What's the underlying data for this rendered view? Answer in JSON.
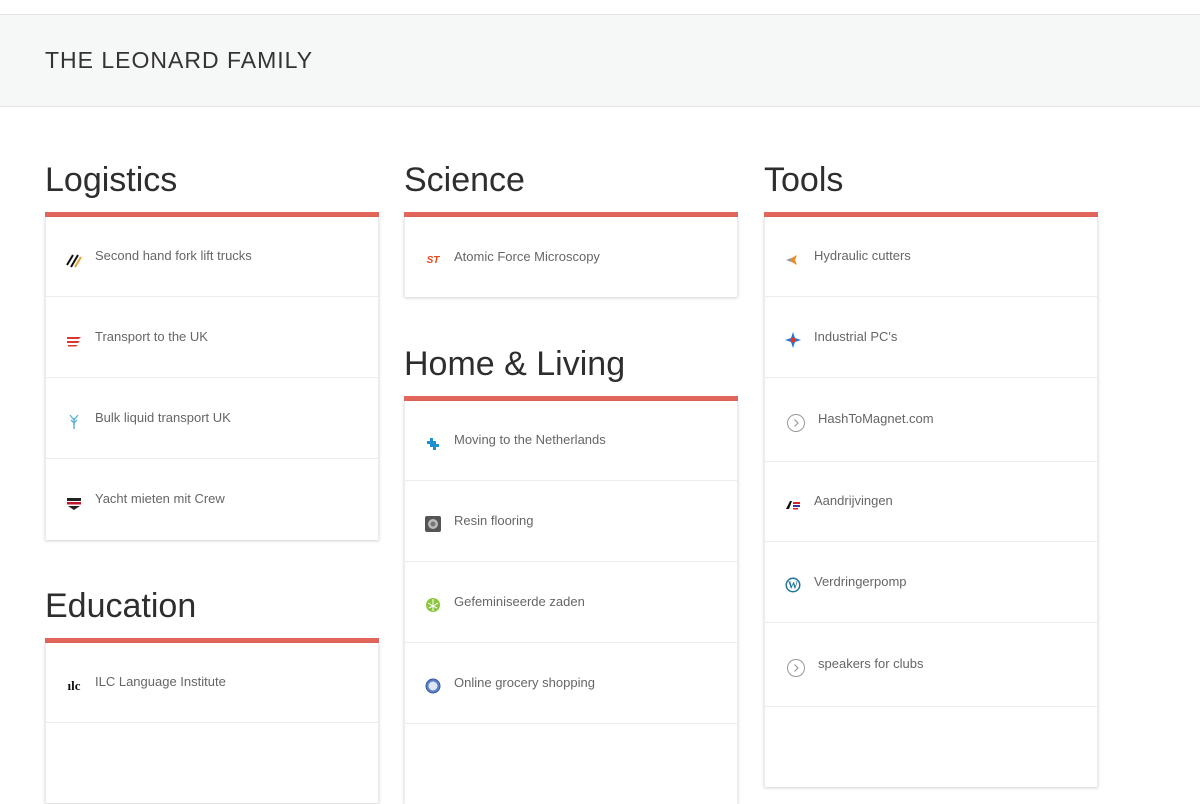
{
  "site": {
    "title": "THE LEONARD FAMILY"
  },
  "sections": {
    "logistics": {
      "heading": "Logistics",
      "items": [
        {
          "label": "Second hand fork lift trucks",
          "icon": "diagonal-stripes-icon"
        },
        {
          "label": "Transport to the UK",
          "icon": "red-wave-logo-icon"
        },
        {
          "label": "Bulk liquid transport UK",
          "icon": "blue-tree-icon"
        },
        {
          "label": "Yacht mieten mit Crew",
          "icon": "flag-stripes-icon"
        }
      ]
    },
    "education": {
      "heading": "Education",
      "items": [
        {
          "label": "ILC Language Institute",
          "icon": "ilc-logo-icon",
          "icon_text": "ılc"
        }
      ]
    },
    "science": {
      "heading": "Science",
      "items": [
        {
          "label": "Atomic Force Microscopy",
          "icon": "st-logo-icon",
          "icon_text": "ST"
        }
      ]
    },
    "home_living": {
      "heading": "Home & Living",
      "items": [
        {
          "label": "Moving to the Netherlands",
          "icon": "blue-puzzle-icon"
        },
        {
          "label": "Resin flooring",
          "icon": "grey-circle-logo-icon"
        },
        {
          "label": "Gefeminiseerde zaden",
          "icon": "green-leaf-icon"
        },
        {
          "label": "Online grocery shopping",
          "icon": "globe-icon"
        }
      ]
    },
    "tools": {
      "heading": "Tools",
      "items": [
        {
          "label": "Hydraulic cutters",
          "icon": "orange-chevron-icon"
        },
        {
          "label": "Industrial PC's",
          "icon": "compass-star-icon"
        },
        {
          "label": "HashToMagnet.com",
          "icon": "circle-arrow-icon"
        },
        {
          "label": "Aandrijvingen",
          "icon": "flag-logo-icon"
        },
        {
          "label": "Verdringerpomp",
          "icon": "wordpress-icon"
        },
        {
          "label": "speakers for clubs",
          "icon": "circle-arrow-icon"
        }
      ]
    }
  },
  "colors": {
    "accent": "#e2665c",
    "header_bg": "#f6f7f7",
    "text": "#666666"
  }
}
